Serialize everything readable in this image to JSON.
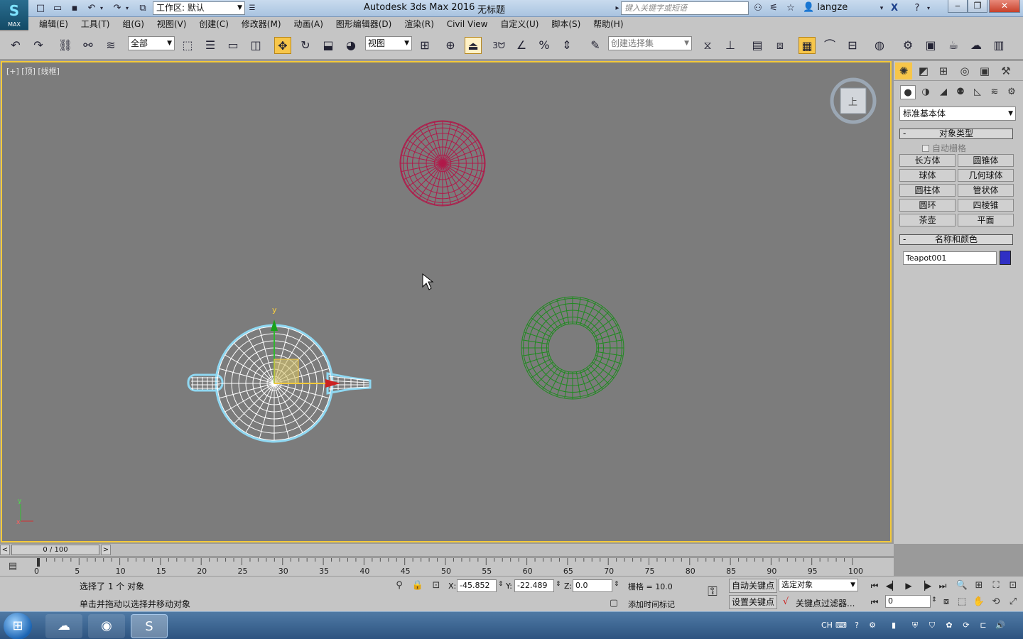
{
  "app": {
    "logo_label": "MAX",
    "workspace_label": "工作区: 默认",
    "title": "Autodesk 3ds Max 2016",
    "doc_title": "无标题",
    "search_placeholder": "键入关键字或短语",
    "user": "langze"
  },
  "menu": [
    "编辑(E)",
    "工具(T)",
    "组(G)",
    "视图(V)",
    "创建(C)",
    "修改器(M)",
    "动画(A)",
    "图形编辑器(D)",
    "渲染(R)",
    "Civil View",
    "自定义(U)",
    "脚本(S)",
    "帮助(H)"
  ],
  "toolbar": {
    "selection_filter": "全部",
    "ref_coord": "视图",
    "snap_value": "3",
    "named_selection_placeholder": "创建选择集"
  },
  "viewport": {
    "label": "[+] [顶] [线框]",
    "gizmo_y_label": "y",
    "axis_labels": {
      "x": "x",
      "y": "y"
    },
    "viewcube_face": "上",
    "objects": [
      {
        "name": "sphere",
        "color": "#b01a4a"
      },
      {
        "name": "torus",
        "color": "#1f8a1f"
      },
      {
        "name": "teapot",
        "color": "#ffffff",
        "selected": true
      }
    ],
    "highlight_color": "#f3c93a"
  },
  "command_panel": {
    "category": "标准基本体",
    "object_type_title": "对象类型",
    "autogrid": "自动栅格",
    "object_buttons": [
      "长方体",
      "圆锥体",
      "球体",
      "几何球体",
      "圆柱体",
      "管状体",
      "圆环",
      "四棱锥",
      "茶壶",
      "平面"
    ],
    "name_color_title": "名称和颜色",
    "object_name": "Teapot001",
    "object_color": "#2f2fc4"
  },
  "timeline": {
    "frame_display": "0 / 100",
    "ticks": [
      "0",
      "5",
      "10",
      "15",
      "20",
      "25",
      "30",
      "35",
      "40",
      "45",
      "50",
      "55",
      "60",
      "65",
      "70",
      "75",
      "80",
      "85",
      "90",
      "95",
      "100"
    ]
  },
  "status": {
    "selection_text": "选择了 1 个 对象",
    "prompt_text": "单击并拖动以选择并移动对象",
    "x_label": "X:",
    "x_value": "-45.852",
    "y_label": "Y:",
    "y_value": "-22.489",
    "z_label": "Z:",
    "z_value": "0.0",
    "grid_text": "栅格 = 10.0",
    "add_time_tag": "添加时间标记",
    "auto_key": "自动关键点",
    "set_key": "设置关键点",
    "key_mode": "选定对象",
    "key_filters": "关键点过滤器...",
    "current_frame": "0"
  },
  "taskbar": {
    "lang": "CH",
    "apps": [
      "start",
      "network-app",
      "chrome",
      "3ds-max"
    ]
  }
}
